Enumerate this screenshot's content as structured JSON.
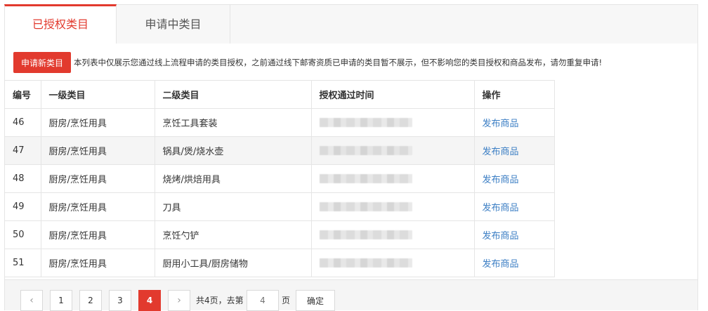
{
  "tabs": [
    {
      "label": "已授权类目",
      "active": true
    },
    {
      "label": "申请中类目",
      "active": false
    }
  ],
  "notice": {
    "button_label": "申请新类目",
    "text": "本列表中仅展示您通过线上流程申请的类目授权，之前通过线下邮寄资质已申请的类目暂不展示，但不影响您的类目授权和商品发布，请勿重复申请!"
  },
  "table": {
    "headers": [
      "编号",
      "一级类目",
      "二级类目",
      "授权通过时间",
      "操作"
    ],
    "rows": [
      {
        "id": "46",
        "cat1": "厨房/烹饪用具",
        "cat2": "烹饪工具套装",
        "time": "",
        "action": "发布商品"
      },
      {
        "id": "47",
        "cat1": "厨房/烹饪用具",
        "cat2": "锅具/煲/烧水壶",
        "time": "",
        "action": "发布商品"
      },
      {
        "id": "48",
        "cat1": "厨房/烹饪用具",
        "cat2": "烧烤/烘焙用具",
        "time": "",
        "action": "发布商品"
      },
      {
        "id": "49",
        "cat1": "厨房/烹饪用具",
        "cat2": "刀具",
        "time": "",
        "action": "发布商品"
      },
      {
        "id": "50",
        "cat1": "厨房/烹饪用具",
        "cat2": "烹饪勺铲",
        "time": "",
        "action": "发布商品"
      },
      {
        "id": "51",
        "cat1": "厨房/烹饪用具",
        "cat2": "厨用小工具/厨房储物",
        "time": "",
        "action": "发布商品"
      }
    ]
  },
  "pager": {
    "prev": "‹",
    "pages": [
      "1",
      "2",
      "3",
      "4"
    ],
    "current": "4",
    "next": "›",
    "total_text": "共4页，去第",
    "input_placeholder": "4",
    "suffix": "页",
    "confirm_label": "确定"
  },
  "colors": {
    "accent": "#e23a2e",
    "link": "#3b7ec4",
    "border": "#e5e5e5"
  }
}
